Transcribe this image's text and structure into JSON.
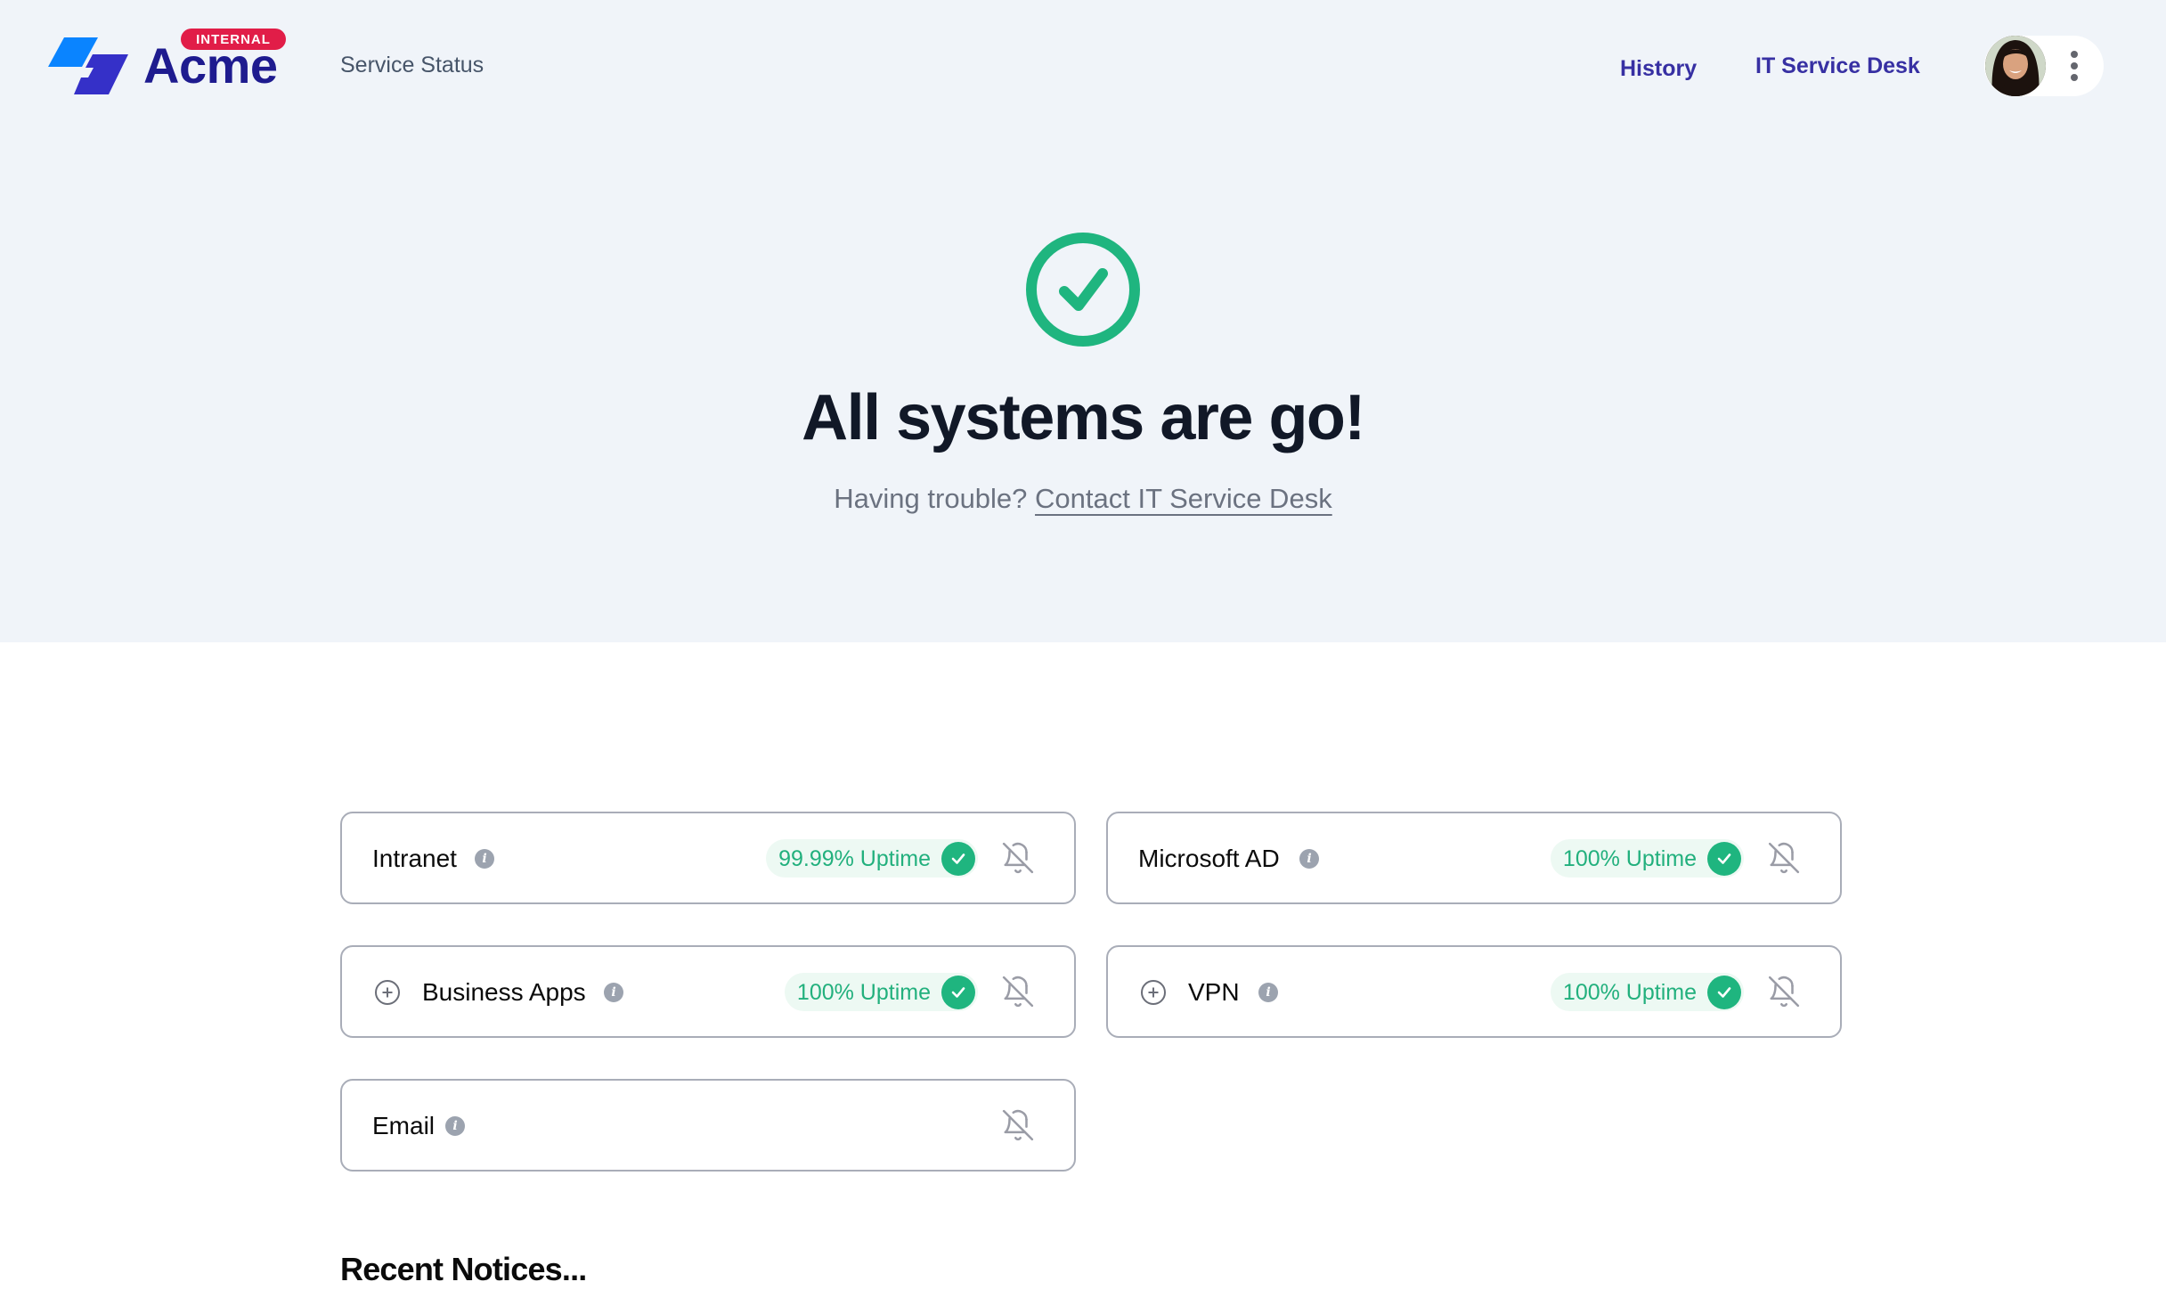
{
  "header": {
    "badge": "INTERNAL",
    "brand": "Acme",
    "app_title": "Service Status",
    "nav": [
      {
        "label": "History"
      },
      {
        "label": "IT Service Desk"
      }
    ],
    "user_menu_icon": "kebab-vertical-icon"
  },
  "hero": {
    "status_icon": "check-circle-icon",
    "title": "All systems are go!",
    "subtitle_prefix": "Having trouble? ",
    "subtitle_link": "Contact IT Service Desk"
  },
  "colors": {
    "brand_primary": "#1e1b8f",
    "brand_light": "#0a84ff",
    "badge": "#e11d48",
    "success": "#1fb57f",
    "nav_link": "#3730a3",
    "hero_bg": "#f0f4f9"
  },
  "services": [
    {
      "name": "Intranet",
      "expandable": false,
      "uptime": "99.99% Uptime",
      "status": "operational"
    },
    {
      "name": "Microsoft AD",
      "expandable": false,
      "uptime": "100% Uptime",
      "status": "operational"
    },
    {
      "name": "Business Apps",
      "expandable": true,
      "uptime": "100% Uptime",
      "status": "operational"
    },
    {
      "name": "VPN",
      "expandable": true,
      "uptime": "100% Uptime",
      "status": "operational"
    },
    {
      "name": "Email",
      "expandable": false,
      "uptime": null,
      "status": "unknown"
    }
  ],
  "notices": {
    "title": "Recent Notices..."
  }
}
